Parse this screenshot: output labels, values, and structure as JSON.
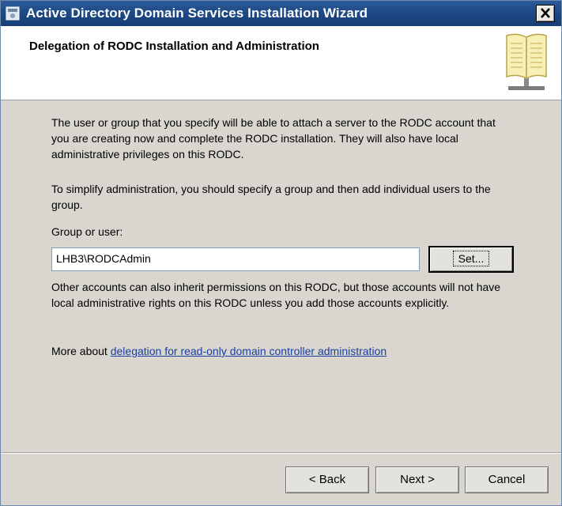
{
  "window": {
    "title": "Active Directory Domain Services Installation Wizard",
    "close_glyph": "✕"
  },
  "header": {
    "heading": "Delegation of RODC Installation and Administration",
    "icon": "book-icon"
  },
  "body": {
    "paragraph1": "The user or group that you specify will be able to attach a server to the RODC account that you are creating now and complete the RODC installation. They will also have local administrative privileges on this RODC.",
    "paragraph2": "To simplify administration, you should specify a group and then add individual users to the group.",
    "group_label": "Group or user:",
    "group_value": "LHB3\\RODCAdmin",
    "set_button": "Set...",
    "paragraph3": "Other accounts can also inherit permissions on this RODC, but those accounts will not have local administrative rights on this RODC unless you add those accounts explicitly.",
    "more_prefix": "More about ",
    "more_link": "delegation for read-only domain controller administration"
  },
  "footer": {
    "back_label": "< Back",
    "next_label": "Next >",
    "cancel_label": "Cancel"
  },
  "colors": {
    "titlebar": "#1f4a86",
    "link": "#1a3ea3",
    "dialog_bg": "#d8d6cf"
  }
}
